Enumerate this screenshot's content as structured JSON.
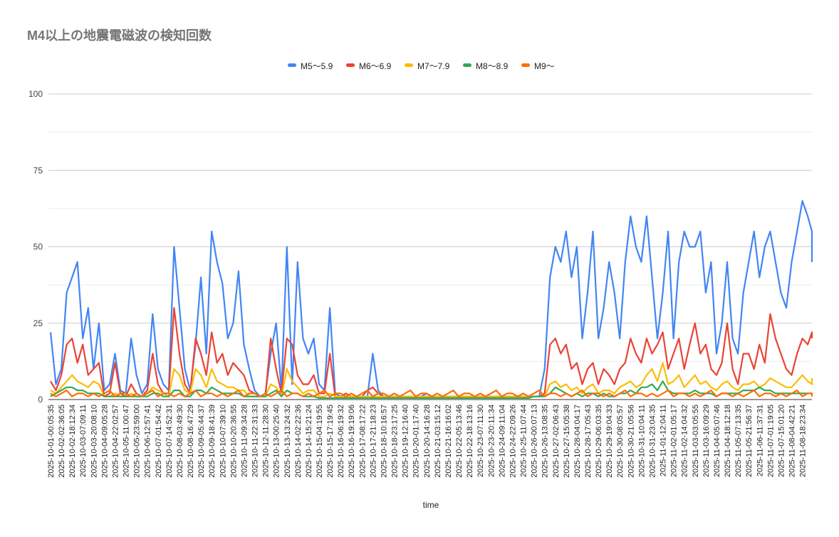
{
  "chart_data": {
    "type": "line",
    "title": "M4以上の地震電磁波の検知回数",
    "xlabel": "time",
    "ylabel": "",
    "ylim": [
      0,
      100
    ],
    "yticks": [
      0,
      25,
      50,
      75,
      100
    ],
    "grid": true,
    "legend_position": "top",
    "x_tick_labels": [
      "2025-10-01-00:05:35",
      "2025-10-02-02:36:05",
      "2025-10-02-18:12:34",
      "2025-10-03-07:09:11",
      "2025-10-03-20:08:10",
      "2025-10-04-09:05:28",
      "2025-10-04-22:02:57",
      "2025-10-05-11:00:47",
      "2025-10-05-23:59:00",
      "2025-10-06-12:57:41",
      "2025-10-07-01:54:42",
      "2025-10-07-14:52:31",
      "2025-10-08-03:49:30",
      "2025-10-08-16:47:29",
      "2025-10-09-05:44:37",
      "2025-10-09-18:41:39",
      "2025-10-10-07:39:10",
      "2025-10-10-20:36:55",
      "2025-10-11-09:34:28",
      "2025-10-11-22:31:33",
      "2025-10-12-11:28:30",
      "2025-10-13-00:25:40",
      "2025-10-13-13:24:32",
      "2025-10-14-02:22:36",
      "2025-10-14-15:21:24",
      "2025-10-15-04:19:55",
      "2025-10-15-17:19:45",
      "2025-10-16-06:19:32",
      "2025-10-16-19:19:06",
      "2025-10-17-08:17:22",
      "2025-10-17-21:18:23",
      "2025-10-18-10:16:57",
      "2025-10-18-23:17:25",
      "2025-10-19-12:16:40",
      "2025-10-20-01:17:40",
      "2025-10-20-14:16:28",
      "2025-10-21-03:15:12",
      "2025-10-21-16:16:02",
      "2025-10-22-05:13:46",
      "2025-10-22-18:13:16",
      "2025-10-23-07:11:30",
      "2025-10-23-20:11:34",
      "2025-10-24-09:11:04",
      "2025-10-24-22:09:26",
      "2025-10-25-11:07:44",
      "2025-10-26-00:07:13",
      "2025-10-26-13:08:35",
      "2025-10-27-02:06:43",
      "2025-10-27-15:05:38",
      "2025-10-28-04:04:17",
      "2025-10-28-17:05:43",
      "2025-10-29-06:03:35",
      "2025-10-29-19:04:33",
      "2025-10-30-08:05:57",
      "2025-10-30-21:05:56",
      "2025-10-31-10:04:11",
      "2025-10-31-23:04:35",
      "2025-11-01-12:04:11",
      "2025-11-02-01:05:17",
      "2025-11-02-14:04:32",
      "2025-11-03-03:05:55",
      "2025-11-03-16:09:29",
      "2025-11-04-05:07:46",
      "2025-11-04-18:12:18",
      "2025-11-05-07:13:35",
      "2025-11-05-21:56:37",
      "2025-11-06-11:37:31",
      "2025-11-07-01:19:05",
      "2025-11-07-15:01:20",
      "2025-11-08-04:42:21",
      "2025-11-08-18:23:34"
    ],
    "points_per_tick": 2,
    "series": [
      {
        "name": "M5〜5.9",
        "color": "#4285f4",
        "values": [
          22,
          5,
          10,
          35,
          40,
          45,
          20,
          30,
          10,
          25,
          3,
          5,
          15,
          3,
          2,
          20,
          8,
          2,
          5,
          28,
          10,
          5,
          3,
          50,
          30,
          10,
          3,
          18,
          40,
          15,
          55,
          45,
          38,
          20,
          25,
          42,
          18,
          10,
          3,
          1,
          2,
          15,
          25,
          3,
          50,
          5,
          45,
          20,
          15,
          20,
          5,
          3,
          30,
          2,
          1,
          1,
          1,
          1,
          1,
          1,
          15,
          3,
          1,
          1,
          1,
          1,
          1,
          1,
          1,
          1,
          2,
          1,
          1,
          1,
          1,
          1,
          1,
          1,
          1,
          1,
          1,
          1,
          1,
          1,
          1,
          1,
          1,
          1,
          1,
          1,
          1,
          1,
          10,
          40,
          50,
          45,
          55,
          40,
          50,
          20,
          35,
          55,
          20,
          30,
          45,
          35,
          20,
          45,
          60,
          50,
          45,
          60,
          40,
          20,
          35,
          55,
          20,
          45,
          55,
          50,
          50,
          55,
          35,
          45,
          15,
          25,
          45,
          20,
          15,
          35,
          45,
          55,
          40,
          50,
          55,
          45,
          35,
          30,
          45,
          55,
          65,
          60,
          55,
          45
        ]
      },
      {
        "name": "M6〜6.9",
        "color": "#ea4335",
        "values": [
          6,
          3,
          8,
          18,
          20,
          12,
          18,
          8,
          10,
          12,
          1,
          2,
          12,
          2,
          1,
          5,
          2,
          1,
          3,
          15,
          5,
          2,
          2,
          30,
          15,
          5,
          2,
          20,
          15,
          8,
          22,
          12,
          15,
          8,
          12,
          10,
          8,
          3,
          2,
          1,
          1,
          20,
          10,
          2,
          20,
          18,
          8,
          5,
          5,
          8,
          2,
          2,
          15,
          1,
          1,
          2,
          1,
          1,
          1,
          3,
          4,
          2,
          1,
          1,
          1,
          1,
          1,
          1,
          1,
          1,
          1,
          1,
          1,
          1,
          1,
          1,
          1,
          1,
          1,
          1,
          1,
          1,
          1,
          1,
          1,
          1,
          1,
          1,
          1,
          1,
          1,
          1,
          2,
          18,
          20,
          15,
          18,
          10,
          12,
          5,
          10,
          12,
          5,
          10,
          8,
          5,
          10,
          12,
          20,
          15,
          12,
          20,
          15,
          18,
          22,
          10,
          15,
          20,
          10,
          18,
          25,
          15,
          18,
          10,
          8,
          12,
          25,
          10,
          5,
          15,
          15,
          10,
          18,
          12,
          28,
          20,
          15,
          10,
          8,
          15,
          20,
          18,
          22,
          20
        ]
      },
      {
        "name": "M7〜7.9",
        "color": "#fbbc04",
        "values": [
          3,
          2,
          4,
          6,
          8,
          6,
          5,
          4,
          6,
          5,
          1,
          1,
          2,
          1,
          1,
          2,
          1,
          1,
          2,
          4,
          3,
          2,
          1,
          10,
          8,
          3,
          2,
          10,
          8,
          4,
          10,
          6,
          5,
          4,
          4,
          3,
          3,
          1,
          1,
          1,
          1,
          5,
          4,
          1,
          10,
          6,
          4,
          2,
          3,
          3,
          1,
          1,
          2,
          1,
          1,
          1,
          1,
          1,
          1,
          1,
          1,
          1,
          1,
          1,
          1,
          1,
          1,
          1,
          1,
          1,
          1,
          1,
          1,
          1,
          1,
          1,
          1,
          1,
          1,
          1,
          1,
          1,
          1,
          1,
          1,
          1,
          1,
          1,
          1,
          1,
          1,
          1,
          1,
          5,
          6,
          4,
          5,
          3,
          4,
          2,
          4,
          5,
          2,
          3,
          3,
          2,
          4,
          5,
          6,
          4,
          5,
          8,
          10,
          6,
          12,
          5,
          6,
          8,
          4,
          6,
          8,
          5,
          6,
          4,
          3,
          5,
          6,
          4,
          3,
          5,
          5,
          6,
          4,
          5,
          7,
          6,
          5,
          4,
          4,
          6,
          8,
          6,
          5,
          7
        ]
      },
      {
        "name": "M8〜8.9",
        "color": "#34a853",
        "values": [
          1,
          2,
          3,
          4,
          4,
          3,
          3,
          2,
          2,
          2,
          1,
          1,
          1,
          1,
          1,
          1,
          1,
          1,
          1,
          2,
          2,
          1,
          1,
          3,
          3,
          1,
          1,
          3,
          3,
          2,
          4,
          3,
          2,
          2,
          2,
          2,
          1,
          1,
          1,
          1,
          1,
          2,
          3,
          1,
          3,
          2,
          2,
          1,
          1,
          1,
          0.5,
          0.5,
          0.5,
          0.5,
          0.5,
          0.5,
          0.5,
          0.5,
          0.5,
          0.5,
          0.5,
          0.5,
          0.5,
          0.5,
          0.5,
          0.5,
          0.5,
          0.5,
          0.5,
          0.5,
          0.5,
          0.5,
          0.5,
          0.5,
          0.5,
          0.5,
          0.5,
          0.5,
          0.5,
          0.5,
          0.5,
          0.5,
          0.5,
          0.5,
          0.5,
          0.5,
          0.5,
          0.5,
          0.5,
          0.5,
          1,
          1,
          1,
          2,
          4,
          3,
          2,
          1,
          2,
          1,
          2,
          2,
          1,
          2,
          1,
          1,
          2,
          2,
          3,
          2,
          4,
          4,
          5,
          3,
          6,
          3,
          2,
          2,
          2,
          2,
          3,
          2,
          2,
          2,
          1,
          2,
          2,
          2,
          2,
          3,
          3,
          3,
          4,
          3,
          3,
          2,
          2,
          2,
          2,
          2,
          2,
          2,
          2,
          2
        ]
      },
      {
        "name": "M9〜",
        "color": "#ff6d01",
        "values": [
          2,
          1,
          2,
          3,
          1,
          2,
          2,
          1,
          2,
          1,
          2,
          3,
          1,
          2,
          2,
          1,
          2,
          1,
          2,
          3,
          1,
          2,
          2,
          1,
          2,
          1,
          2,
          3,
          1,
          2,
          2,
          1,
          2,
          1,
          2,
          3,
          1,
          2,
          2,
          1,
          2,
          1,
          2,
          3,
          1,
          2,
          2,
          1,
          2,
          1,
          2,
          3,
          1,
          2,
          2,
          1,
          2,
          1,
          2,
          3,
          1,
          2,
          2,
          1,
          2,
          1,
          2,
          3,
          1,
          2,
          2,
          1,
          2,
          1,
          2,
          3,
          1,
          2,
          2,
          1,
          2,
          1,
          2,
          3,
          1,
          2,
          2,
          1,
          2,
          1,
          2,
          3,
          1,
          2,
          2,
          1,
          2,
          1,
          2,
          3,
          1,
          2,
          2,
          1,
          2,
          1,
          2,
          3,
          1,
          2,
          2,
          1,
          2,
          1,
          2,
          3,
          1,
          2,
          2,
          1,
          2,
          1,
          2,
          3,
          1,
          2,
          2,
          1,
          2,
          1,
          2,
          3,
          1,
          2,
          2,
          1,
          2,
          1,
          2,
          3,
          1,
          2,
          2,
          1
        ]
      }
    ]
  }
}
